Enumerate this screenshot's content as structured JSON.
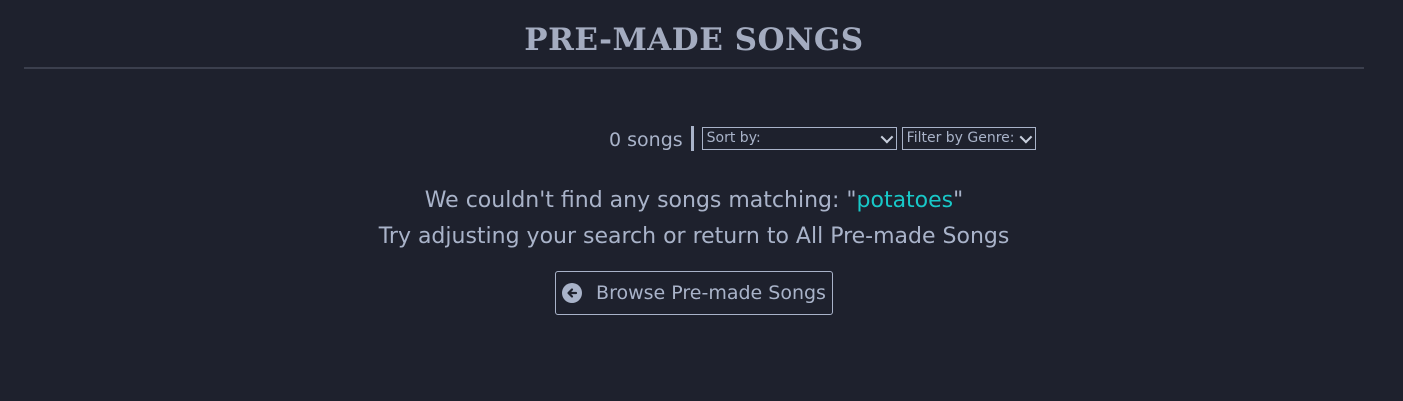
{
  "header": {
    "title": "PRE-MADE SONGS"
  },
  "controls": {
    "count_text": "0 songs",
    "sort_label": "Sort by:",
    "genre_label": "Filter by Genre:"
  },
  "message": {
    "prefix": "We couldn't find any songs matching: \"",
    "query": "potatoes",
    "suffix": "\"",
    "hint": "Try adjusting your search or return to All Pre-made Songs"
  },
  "browse_button": {
    "label": "Browse Pre-made Songs",
    "icon": "arrow-circle-left-icon"
  },
  "colors": {
    "background": "#1e212d",
    "text": "#a9b3c9",
    "accent": "#18c8c8"
  }
}
